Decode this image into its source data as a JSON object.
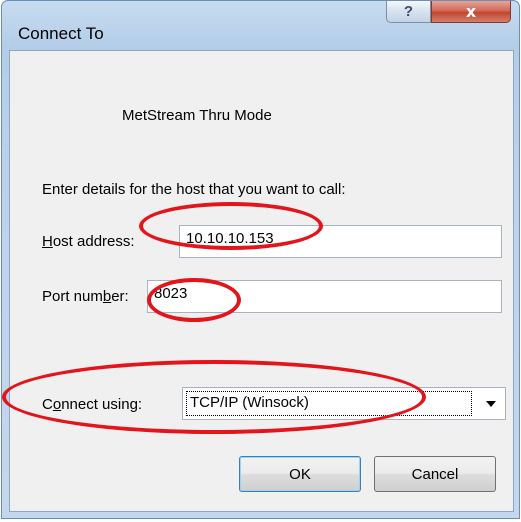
{
  "window": {
    "title": "Connect To",
    "help_glyph": "?",
    "close_glyph": "x",
    "caption": "MetStream Thru Mode",
    "instructions": "Enter details for the host that you want to call:"
  },
  "host": {
    "label": "Host address:",
    "value": "10.10.10.153"
  },
  "port": {
    "label": "Port number:",
    "value": "8023"
  },
  "connect": {
    "label": "Connect using:",
    "selected": "TCP/IP (Winsock)"
  },
  "buttons": {
    "ok": "OK",
    "cancel": "Cancel"
  },
  "annotations": {
    "highlight_color": "#e4141b"
  }
}
